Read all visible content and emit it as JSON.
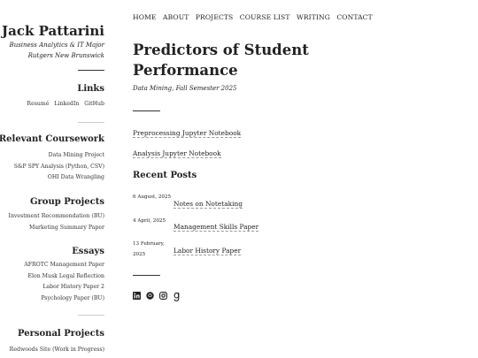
{
  "sidebar": {
    "name": "Jack Pattarini",
    "tagline_line1": "Business Analytics & IT Major",
    "tagline_line2": "Rutgers New Brunswick",
    "links_heading": "Links",
    "links": [
      "Resumé",
      "LinkedIn",
      "GitHub"
    ],
    "coursework_heading": "Relevant Coursework",
    "coursework": [
      "Data Mining Project",
      "S&P SPY Analysis (Python, CSV)",
      "OHI Data Wrangling"
    ],
    "group_heading": "Group Projects",
    "group": [
      "Investment Recommendation (BU)",
      "Marketing Summary Paper"
    ],
    "essays_heading": "Essays",
    "essays": [
      "AFROTC Management Paper",
      "Elon Musk Legal Reflection",
      "Labor History Paper 2",
      "Psychology Paper (BU)"
    ],
    "personal_heading": "Personal Projects",
    "personal": [
      "Redwoods Site (Work in Progress)"
    ]
  },
  "nav": [
    "HOME",
    "ABOUT",
    "PROJECTS",
    "COURSE LIST",
    "WRITING",
    "CONTACT"
  ],
  "main": {
    "title_line1": "Predictors of Student",
    "title_line2": "Performance",
    "subtitle": "Data Mining, Fall Semester 2025",
    "notebooks": [
      "Preprocessing Jupyter Notebook",
      "Analysis Jupyter Notebook"
    ],
    "recent_heading": "Recent Posts",
    "posts": [
      {
        "date": "6 August, 2025",
        "title": "Notes on Notetaking"
      },
      {
        "date": "4 April, 2025",
        "title": "Management Skills Paper"
      },
      {
        "date": "13 February, 2025",
        "title": "Labor History Paper"
      }
    ]
  },
  "social_icons": [
    "linkedin-icon",
    "github-icon",
    "instagram-icon",
    "goodreads-icon"
  ],
  "colors": {
    "text": "#222222",
    "rule": "#333333",
    "light_rule": "#cccccc",
    "dash": "#999999"
  }
}
